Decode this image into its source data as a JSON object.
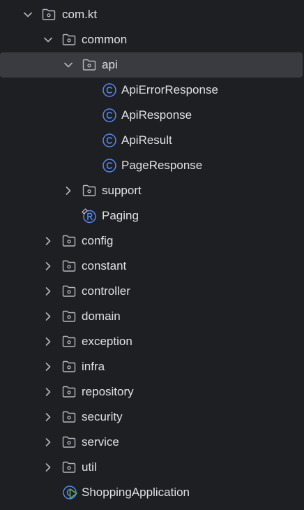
{
  "tree": {
    "items": [
      {
        "label": "com.kt",
        "icon": "folder-package-icon",
        "state": "expanded"
      },
      {
        "label": "common",
        "icon": "folder-package-icon",
        "state": "expanded"
      },
      {
        "label": "api",
        "icon": "folder-package-icon",
        "state": "expanded"
      },
      {
        "label": "ApiErrorResponse",
        "icon": "class-icon"
      },
      {
        "label": "ApiResponse",
        "icon": "class-icon"
      },
      {
        "label": "ApiResult",
        "icon": "class-icon"
      },
      {
        "label": "PageResponse",
        "icon": "class-icon"
      },
      {
        "label": "support",
        "icon": "folder-package-icon",
        "state": "collapsed"
      },
      {
        "label": "Paging",
        "icon": "record-icon"
      },
      {
        "label": "config",
        "icon": "folder-package-icon",
        "state": "collapsed"
      },
      {
        "label": "constant",
        "icon": "folder-package-icon",
        "state": "collapsed"
      },
      {
        "label": "controller",
        "icon": "folder-package-icon",
        "state": "collapsed"
      },
      {
        "label": "domain",
        "icon": "folder-package-icon",
        "state": "collapsed"
      },
      {
        "label": "exception",
        "icon": "folder-package-icon",
        "state": "collapsed"
      },
      {
        "label": "infra",
        "icon": "folder-package-icon",
        "state": "collapsed"
      },
      {
        "label": "repository",
        "icon": "folder-package-icon",
        "state": "collapsed"
      },
      {
        "label": "security",
        "icon": "folder-package-icon",
        "state": "collapsed"
      },
      {
        "label": "service",
        "icon": "folder-package-icon",
        "state": "collapsed"
      },
      {
        "label": "util",
        "icon": "folder-package-icon",
        "state": "collapsed"
      },
      {
        "label": "ShoppingApplication",
        "icon": "spring-boot-class-icon"
      }
    ],
    "selected": "api"
  },
  "colors": {
    "background": "#1e1f22",
    "selection": "#393b40",
    "text": "#dfe1e5",
    "icon_gray": "#b4b8bf",
    "class_blue": "#548af7",
    "run_green": "#5fb865"
  }
}
